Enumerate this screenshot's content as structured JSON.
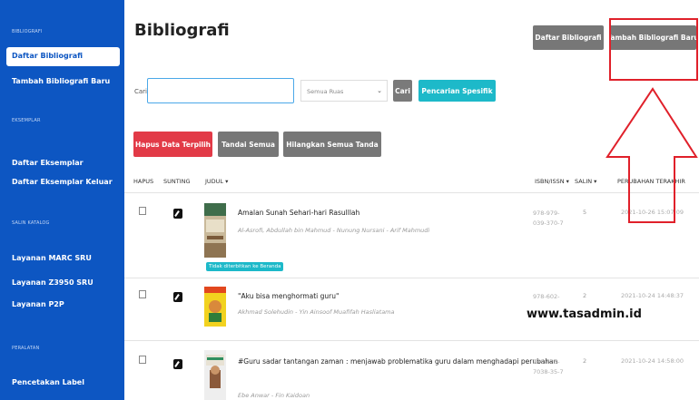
{
  "sidebar": {
    "sections": [
      {
        "label": "BIBLIOGRAFI"
      },
      {
        "label": "EKSEMPLAR"
      },
      {
        "label": "SALIN KATALOG"
      },
      {
        "label": "PERALATAN"
      }
    ],
    "items": [
      {
        "label": "Daftar Bibliografi"
      },
      {
        "label": "Tambah Bibliografi Baru"
      },
      {
        "label": "Daftar Eksemplar"
      },
      {
        "label": "Daftar Eksemplar Keluar"
      },
      {
        "label": "Layanan MARC SRU"
      },
      {
        "label": "Layanan Z3950 SRU"
      },
      {
        "label": "Layanan P2P"
      },
      {
        "label": "Pencetakan Label"
      }
    ]
  },
  "header": {
    "title": "Bibliografi",
    "list_button": "Daftar Bibliografi",
    "add_button": "Tambah Bibliografi Baru"
  },
  "search": {
    "label": "Cari",
    "value": "",
    "field_select": "Semua Ruas",
    "search_button": "Cari",
    "advanced_button": "Pencarian Spesifik"
  },
  "actions": {
    "delete_selected": "Hapus Data Terpilih",
    "mark_all": "Tandai Semua",
    "unmark_all": "Hilangkan Semua Tanda"
  },
  "table": {
    "headers": [
      "HAPUS",
      "SUNTING",
      "JUDUL ▾",
      "ISBN/ISSN ▾",
      "SALIN ▾",
      "PERUBAHAN TERAKHIR"
    ],
    "rows": [
      {
        "title": "Amalan Sunah Sehari-hari Rasulllah",
        "authors": "Al-Asrofi, Abdullah bin Mahmud - Nunung Nursani - Arif Mahmudi",
        "badge": "Tidak diterbitkan ke Beranda",
        "isbn": "978-979-039-370-7",
        "copies": "5",
        "updated": "2021-10-26 15:07:09"
      },
      {
        "title": "\"Aku bisa menghormati guru\"",
        "authors": "Akhmad Solehudin - Yin Ainsoof Muafifah Hasliatama",
        "badge": "",
        "isbn": "978-602-",
        "copies": "2",
        "updated": "2021-10-24 14:48:37"
      },
      {
        "title": "#Guru sadar tantangan zaman : menjawab problematika guru dalam menghadapi perubahan",
        "authors": "Ebe Anwar - Fin Kaidoan",
        "badge": "",
        "isbn": "978-623-7038-35-7",
        "copies": "2",
        "updated": "2021-10-24 14:58:00"
      }
    ]
  },
  "watermark": "www.tasadmin.id",
  "colors": {
    "sidebar": "#0d56c2",
    "danger": "#e23a47",
    "info": "#1db9c9",
    "secondary": "#777777",
    "annotation": "#e0202a"
  }
}
